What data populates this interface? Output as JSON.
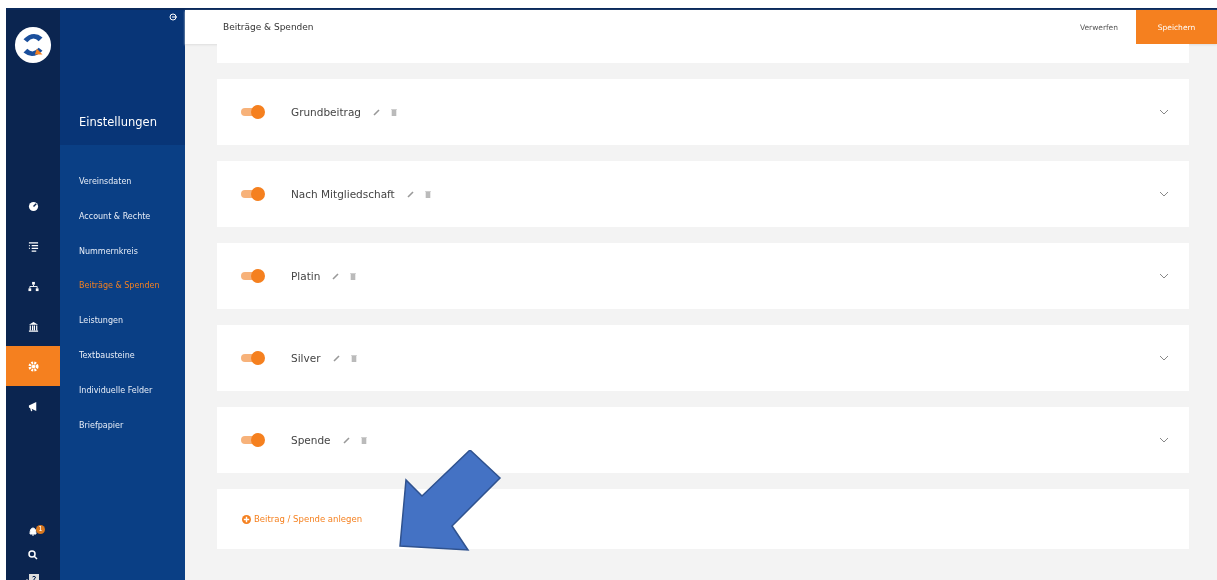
{
  "rail": {
    "items": [
      {
        "kind": "dashboard",
        "selected": false
      },
      {
        "kind": "list",
        "selected": false
      },
      {
        "kind": "hierarchy",
        "selected": false
      },
      {
        "kind": "bank",
        "selected": false
      },
      {
        "kind": "settings",
        "selected": true
      },
      {
        "kind": "megaphone",
        "selected": false
      }
    ],
    "notification_badge": "1"
  },
  "submenu": {
    "title": "Einstellungen",
    "items": [
      {
        "label": "Vereinsdaten",
        "selected": false
      },
      {
        "label": "Account & Rechte",
        "selected": false
      },
      {
        "label": "Nummernkreis",
        "selected": false
      },
      {
        "label": "Beiträge & Spenden",
        "selected": true
      },
      {
        "label": "Leistungen",
        "selected": false
      },
      {
        "label": "Textbausteine",
        "selected": false
      },
      {
        "label": "Individuelle Felder",
        "selected": false
      },
      {
        "label": "Briefpapier",
        "selected": false
      }
    ]
  },
  "header": {
    "title": "Beiträge & Spenden",
    "discard": "Verwerfen",
    "save": "Speichern"
  },
  "contributions": [
    {
      "name": "Grundbeitrag",
      "enabled": true
    },
    {
      "name": "Nach Mitgliedschaft",
      "enabled": true
    },
    {
      "name": "Platin",
      "enabled": true
    },
    {
      "name": "Silver",
      "enabled": true
    },
    {
      "name": "Spende",
      "enabled": true
    }
  ],
  "add_button": "Beitrag / Spende anlegen"
}
